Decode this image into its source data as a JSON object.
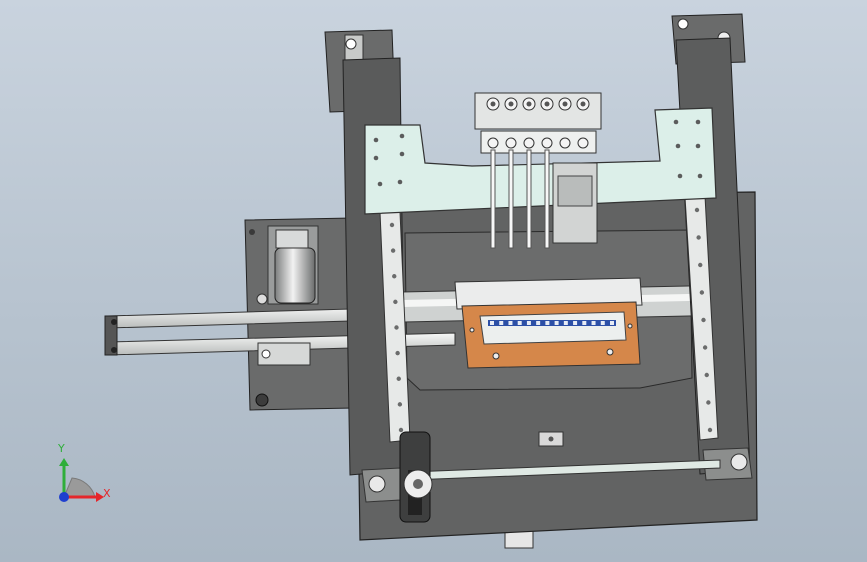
{
  "triad": {
    "x_label": "X",
    "y_label": "Y",
    "colors": {
      "x": "#e5262a",
      "y": "#2fae3a",
      "z": "#1f3fcf",
      "arc": "#8a8a8a"
    }
  },
  "palette": {
    "background_top": "#c9d3de",
    "background_bottom": "#aab7c4",
    "frame_dark": "#4f5050",
    "plate": "#6e6f6f",
    "carriage_mint": "#dcefe9",
    "rail_light": "#eef0ee",
    "pcb_orange": "#d5874a",
    "connector_blue": "#2c4fa6"
  },
  "model": {
    "pin_count": 6,
    "contact_count": 14
  }
}
